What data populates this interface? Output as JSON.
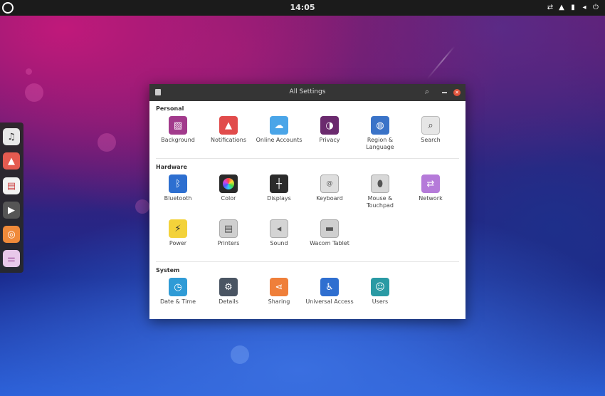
{
  "top_panel": {
    "clock": "14:05"
  },
  "window": {
    "title": "All Settings"
  },
  "sections": {
    "personal": {
      "title": "Personal",
      "items": [
        {
          "label": "Background",
          "icon": "background-icon",
          "color": "#a23a8c"
        },
        {
          "label": "Notifications",
          "icon": "bell-icon",
          "color": "#e14b4b"
        },
        {
          "label": "Online Accounts",
          "icon": "cloud-icon",
          "color": "#4aa5e8"
        },
        {
          "label": "Privacy",
          "icon": "mask-icon",
          "color": "#6b2a6e"
        },
        {
          "label": "Region & Language",
          "icon": "globe-icon",
          "color": "#3a73c8"
        },
        {
          "label": "Search",
          "icon": "magnifier-icon",
          "color": "#e6e6e6"
        }
      ]
    },
    "hardware": {
      "title": "Hardware",
      "items": [
        {
          "label": "Bluetooth",
          "icon": "bluetooth-icon",
          "color": "#2d6fd0"
        },
        {
          "label": "Color",
          "icon": "color-wheel-icon",
          "color": "#2a2a2a"
        },
        {
          "label": "Displays",
          "icon": "display-icon",
          "color": "#2b2b2b"
        },
        {
          "label": "Keyboard",
          "icon": "keyboard-key-icon",
          "color": "#dedede"
        },
        {
          "label": "Mouse & Touchpad",
          "icon": "mouse-icon",
          "color": "#d8d8d8"
        },
        {
          "label": "Network",
          "icon": "network-icon",
          "color": "#b57ad9"
        },
        {
          "label": "Power",
          "icon": "power-icon",
          "color": "#f3d23a"
        },
        {
          "label": "Printers",
          "icon": "printer-icon",
          "color": "#cfcfcf"
        },
        {
          "label": "Sound",
          "icon": "speaker-icon",
          "color": "#d4d4d4"
        },
        {
          "label": "Wacom Tablet",
          "icon": "tablet-icon",
          "color": "#cfcfcf"
        }
      ]
    },
    "system": {
      "title": "System",
      "items": [
        {
          "label": "Date & Time",
          "icon": "clock-icon",
          "color": "#2f9bd6"
        },
        {
          "label": "Details",
          "icon": "gear-icon",
          "color": "#4a5563"
        },
        {
          "label": "Sharing",
          "icon": "share-icon",
          "color": "#ef7f3a"
        },
        {
          "label": "Universal Access",
          "icon": "accessibility-icon",
          "color": "#2f6fd0"
        },
        {
          "label": "Users",
          "icon": "user-icon",
          "color": "#2a9aa4"
        }
      ]
    }
  },
  "dock": [
    {
      "name": "music-app-icon",
      "color": "#e9e9e9"
    },
    {
      "name": "photos-app-icon",
      "color": "#e45b50"
    },
    {
      "name": "calendar-app-icon",
      "color": "#f2f2f2"
    },
    {
      "name": "video-app-icon",
      "color": "#555555"
    },
    {
      "name": "software-app-icon",
      "color": "#ef8a3a"
    },
    {
      "name": "settings-app-icon",
      "color": "#e8c8ea"
    }
  ]
}
